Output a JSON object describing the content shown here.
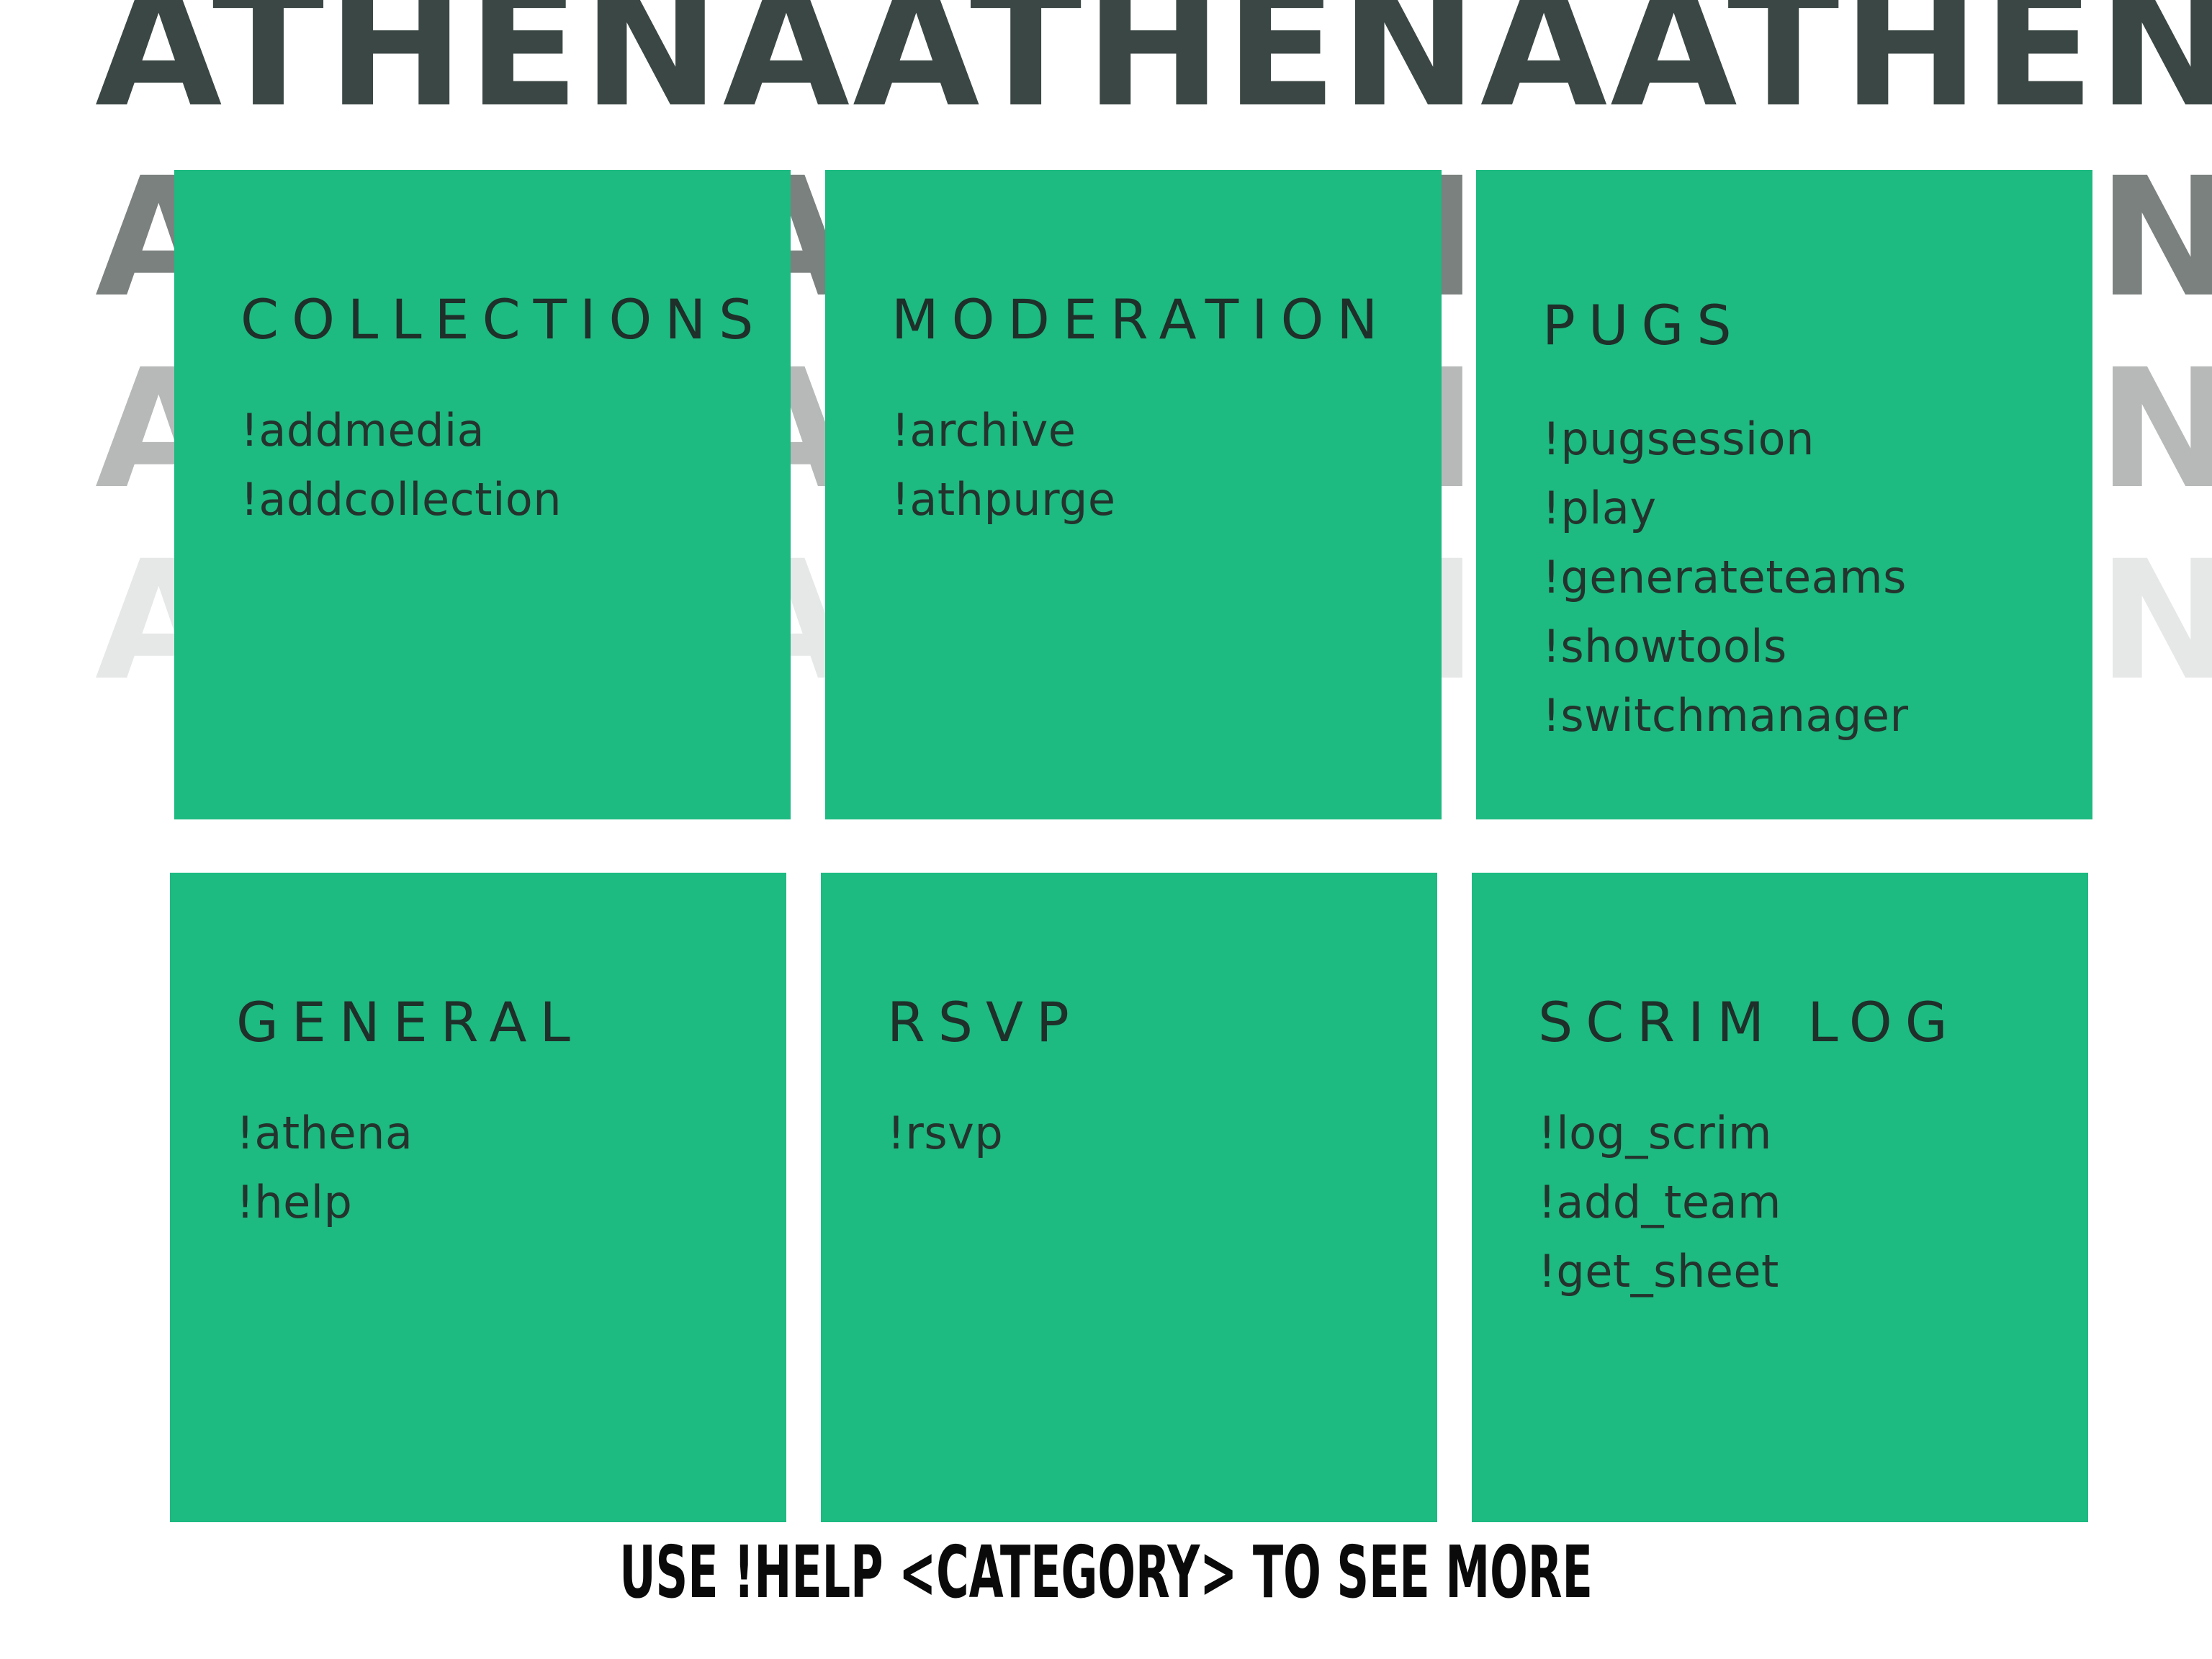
{
  "background": {
    "words": [
      "ATHENA",
      "ATHENA",
      "ATHENA"
    ],
    "row_colors": [
      "#3b4744",
      "#7b817f",
      "#b6b9b8",
      "#e6e7e7"
    ]
  },
  "accent_color": "#1dba81",
  "cards": [
    {
      "title": "COLLECTIONS",
      "commands": [
        "!addmedia",
        "!addcollection"
      ]
    },
    {
      "title": "MODERATION",
      "commands": [
        "!archive",
        "!athpurge"
      ]
    },
    {
      "title": "PUGS",
      "commands": [
        "!pugsession",
        "!play",
        "!generateteams",
        "!showtools",
        "!switchmanager"
      ]
    },
    {
      "title": "GENERAL",
      "commands": [
        "!athena",
        "!help"
      ]
    },
    {
      "title": "RSVP",
      "commands": [
        "!rsvp"
      ]
    },
    {
      "title": "SCRIM LOG",
      "commands": [
        "!log_scrim",
        "!add_team",
        "!get_sheet"
      ]
    }
  ],
  "footer": "USE !HELP <CATEGORY> TO SEE MORE"
}
